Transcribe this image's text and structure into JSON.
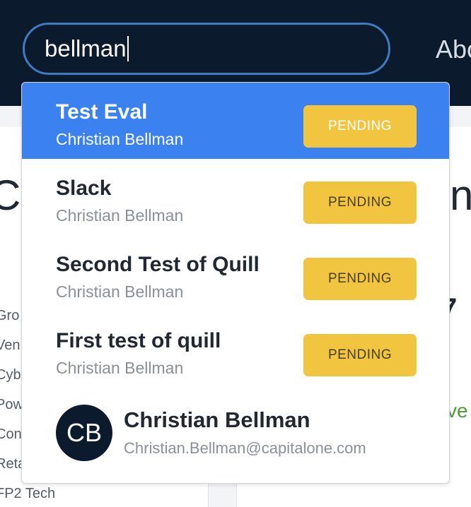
{
  "header": {
    "search": {
      "value": "bellman"
    },
    "nav_about": "Abo"
  },
  "background": {
    "left_letter": "C",
    "right_letter": "n",
    "right_mark": "7",
    "right_fragment": "ve",
    "list_items": [
      "Gro",
      "Ven",
      "Cyb",
      "Pow",
      "Con",
      "Reta",
      "FP2 Tech"
    ]
  },
  "dropdown": {
    "results": [
      {
        "title": "Test Eval",
        "owner": "Christian Bellman",
        "status": "PENDING"
      },
      {
        "title": "Slack",
        "owner": "Christian Bellman",
        "status": "PENDING"
      },
      {
        "title": "Second Test of Quill",
        "owner": "Christian Bellman",
        "status": "PENDING"
      },
      {
        "title": "First test of quill",
        "owner": "Christian Bellman",
        "status": "PENDING"
      }
    ],
    "person": {
      "initials": "CB",
      "name": "Christian Bellman",
      "email": "Christian.Bellman@capitalone.com"
    }
  },
  "colors": {
    "header_bg": "#0c1a2e",
    "search_border": "#3e7bbf",
    "active_row": "#3b82f0",
    "badge": "#f2c541"
  }
}
